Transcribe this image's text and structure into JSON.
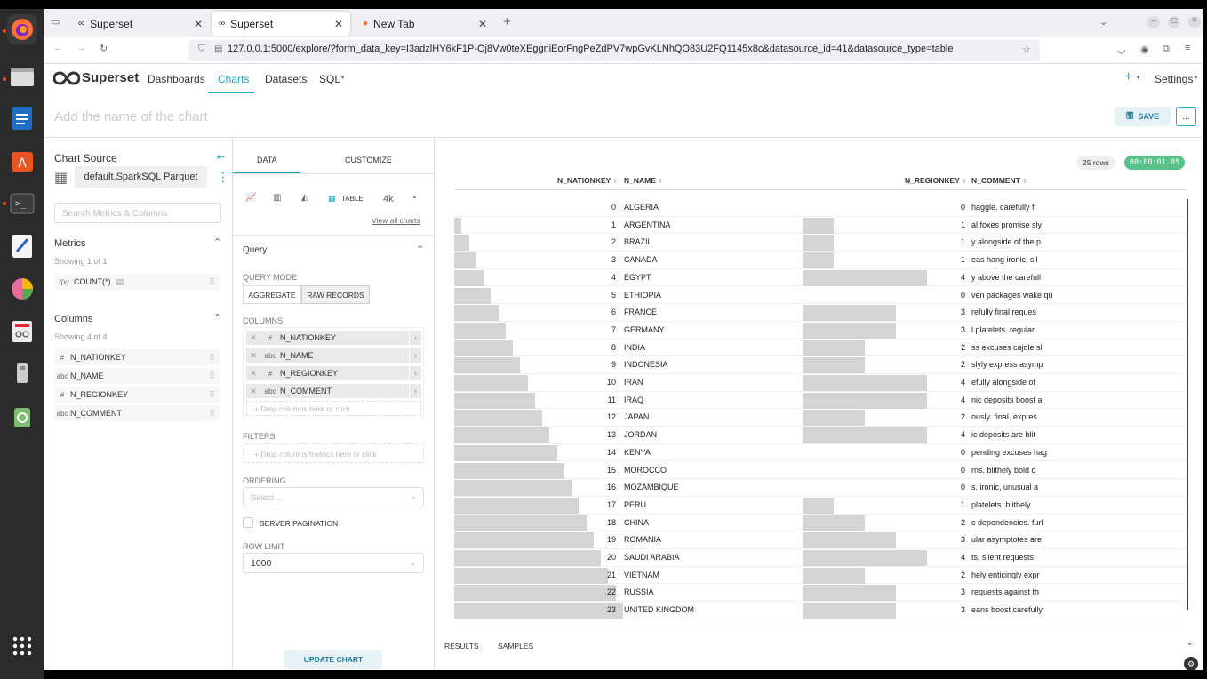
{
  "browser": {
    "tabs": [
      {
        "label": "Superset"
      },
      {
        "label": "Superset"
      },
      {
        "label": "New Tab"
      }
    ],
    "url": "127.0.0.1:5000/explore/?form_data_key=I3adzlHY6kF1P-Oj8Vw0teXEggniEorFngPeZdPV7wpGvKLNhQO83U2FQ1145x8c&datasource_id=41&datasource_type=table"
  },
  "nav": {
    "brand": "Superset",
    "links": [
      "Dashboards",
      "Charts",
      "Datasets",
      "SQL"
    ],
    "settings": "Settings",
    "plus": "+"
  },
  "chart": {
    "title_placeholder": "Add the name of the chart",
    "save": "SAVE",
    "more": "..."
  },
  "left": {
    "chart_source": "Chart Source",
    "datasource": "default.SparkSQL Parquet",
    "search_placeholder": "Search Metrics & Columns",
    "metrics_title": "Metrics",
    "metrics_count": "Showing 1 of 1",
    "metric": "COUNT(*)",
    "metric_type": "f(x)",
    "columns_title": "Columns",
    "columns_count": "Showing 4 of 4",
    "columns": [
      {
        "type": "#",
        "name": "N_NATIONKEY"
      },
      {
        "type": "abc",
        "name": "N_NAME"
      },
      {
        "type": "#",
        "name": "N_REGIONKEY"
      },
      {
        "type": "abc",
        "name": "N_COMMENT"
      }
    ]
  },
  "mid": {
    "tabs": [
      "DATA",
      "CUSTOMIZE"
    ],
    "table_label": "TABLE",
    "k_label": "4k",
    "view_all": "View all charts",
    "query": "Query",
    "query_mode": "QUERY MODE",
    "aggregate": "AGGREGATE",
    "raw": "RAW RECORDS",
    "columns_label": "COLUMNS",
    "pills": [
      {
        "type": "#",
        "name": "N_NATIONKEY"
      },
      {
        "type": "abc",
        "name": "N_NAME"
      },
      {
        "type": "#",
        "name": "N_REGIONKEY"
      },
      {
        "type": "abc",
        "name": "N_COMMENT"
      }
    ],
    "drop_columns": "+ Drop columns here or click",
    "filters": "FILTERS",
    "drop_filters": "+ Drop columns/metrics here or click",
    "ordering": "ORDERING",
    "select_placeholder": "Select ...",
    "server_pagination": "SERVER PAGINATION",
    "row_limit": "ROW LIMIT",
    "row_limit_value": "1000",
    "update": "UPDATE CHART"
  },
  "result": {
    "rows_badge": "25 rows",
    "time_badge": "00:00:01.05",
    "headers": [
      "N_NATIONKEY",
      "N_NAME",
      "N_REGIONKEY",
      "N_COMMENT"
    ],
    "rows": [
      {
        "k": "0",
        "n": "ALGERIA",
        "r": "0",
        "c": "haggle. carefully f"
      },
      {
        "k": "1",
        "n": "ARGENTINA",
        "r": "1",
        "c": "al foxes promise sly"
      },
      {
        "k": "2",
        "n": "BRAZIL",
        "r": "1",
        "c": "y alongside of the p"
      },
      {
        "k": "3",
        "n": "CANADA",
        "r": "1",
        "c": "eas hang ironic, sil"
      },
      {
        "k": "4",
        "n": "EGYPT",
        "r": "4",
        "c": "y above the carefull"
      },
      {
        "k": "5",
        "n": "ETHIOPIA",
        "r": "0",
        "c": "ven packages wake qu"
      },
      {
        "k": "6",
        "n": "FRANCE",
        "r": "3",
        "c": "refully final reques"
      },
      {
        "k": "7",
        "n": "GERMANY",
        "r": "3",
        "c": "l platelets. regular"
      },
      {
        "k": "8",
        "n": "INDIA",
        "r": "2",
        "c": "ss excuses cajole sl"
      },
      {
        "k": "9",
        "n": "INDONESIA",
        "r": "2",
        "c": "slyly express asymp"
      },
      {
        "k": "10",
        "n": "IRAN",
        "r": "4",
        "c": "efully alongside of"
      },
      {
        "k": "11",
        "n": "IRAQ",
        "r": "4",
        "c": "nic deposits boost a"
      },
      {
        "k": "12",
        "n": "JAPAN",
        "r": "2",
        "c": "ously. final, expres"
      },
      {
        "k": "13",
        "n": "JORDAN",
        "r": "4",
        "c": "ic deposits are blit"
      },
      {
        "k": "14",
        "n": "KENYA",
        "r": "0",
        "c": "pending excuses hag"
      },
      {
        "k": "15",
        "n": "MOROCCO",
        "r": "0",
        "c": "rns. blithely bold c"
      },
      {
        "k": "16",
        "n": "MOZAMBIQUE",
        "r": "0",
        "c": "s. ironic, unusual a"
      },
      {
        "k": "17",
        "n": "PERU",
        "r": "1",
        "c": "platelets. blithely"
      },
      {
        "k": "18",
        "n": "CHINA",
        "r": "2",
        "c": "c dependencies. furl"
      },
      {
        "k": "19",
        "n": "ROMANIA",
        "r": "3",
        "c": "ular asymptotes are"
      },
      {
        "k": "20",
        "n": "SAUDI ARABIA",
        "r": "4",
        "c": "ts. silent requests"
      },
      {
        "k": "21",
        "n": "VIETNAM",
        "r": "2",
        "c": "hely enticingly expr"
      },
      {
        "k": "22",
        "n": "RUSSIA",
        "r": "3",
        "c": "requests against th"
      },
      {
        "k": "23",
        "n": "UNITED KINGDOM",
        "r": "3",
        "c": "eans boost carefully"
      }
    ],
    "bottom_tabs": [
      "RESULTS",
      "SAMPLES"
    ]
  },
  "colors": {
    "accent": "#20a7c9",
    "badge_green": "#5ac189",
    "bar": "#d4d4d4"
  }
}
